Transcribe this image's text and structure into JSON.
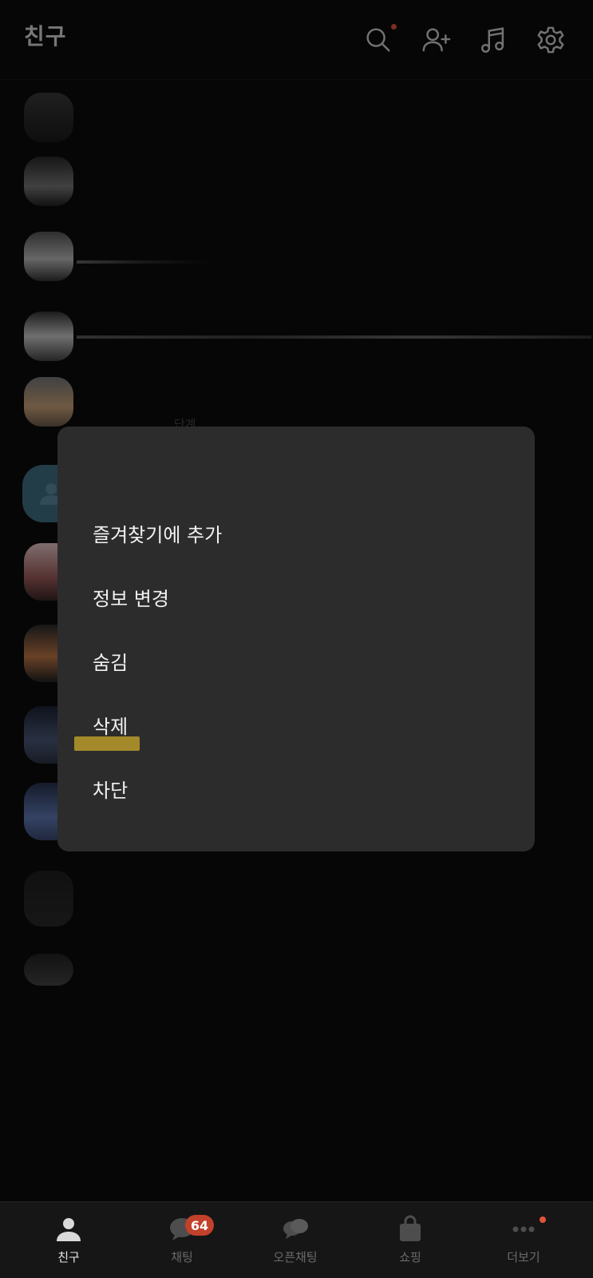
{
  "header": {
    "title": "친구",
    "icons": [
      "search-icon",
      "add-friend-icon",
      "music-icon",
      "settings-icon"
    ],
    "search_notification": true
  },
  "list": {
    "partial_subtext": "단계"
  },
  "menu": {
    "items": [
      {
        "label": "즐겨찾기에 추가"
      },
      {
        "label": "정보 변경"
      },
      {
        "label": "숨김"
      },
      {
        "label": "삭제"
      },
      {
        "label": "차단"
      }
    ]
  },
  "tabbar": {
    "tabs": [
      {
        "label": "친구",
        "icon": "person-icon",
        "active": true
      },
      {
        "label": "채팅",
        "icon": "chat-bubble-icon",
        "badge": "64"
      },
      {
        "label": "오픈채팅",
        "icon": "open-chat-icon"
      },
      {
        "label": "쇼핑",
        "icon": "shopping-bag-icon"
      },
      {
        "label": "더보기",
        "icon": "more-icon",
        "notification": true
      }
    ]
  },
  "colors": {
    "background": "#0b0b0c",
    "menu_background": "#2c2c2d",
    "badge": "#c2412b",
    "highlight": "#b89a2a",
    "notification_dot": "#e2543c"
  }
}
